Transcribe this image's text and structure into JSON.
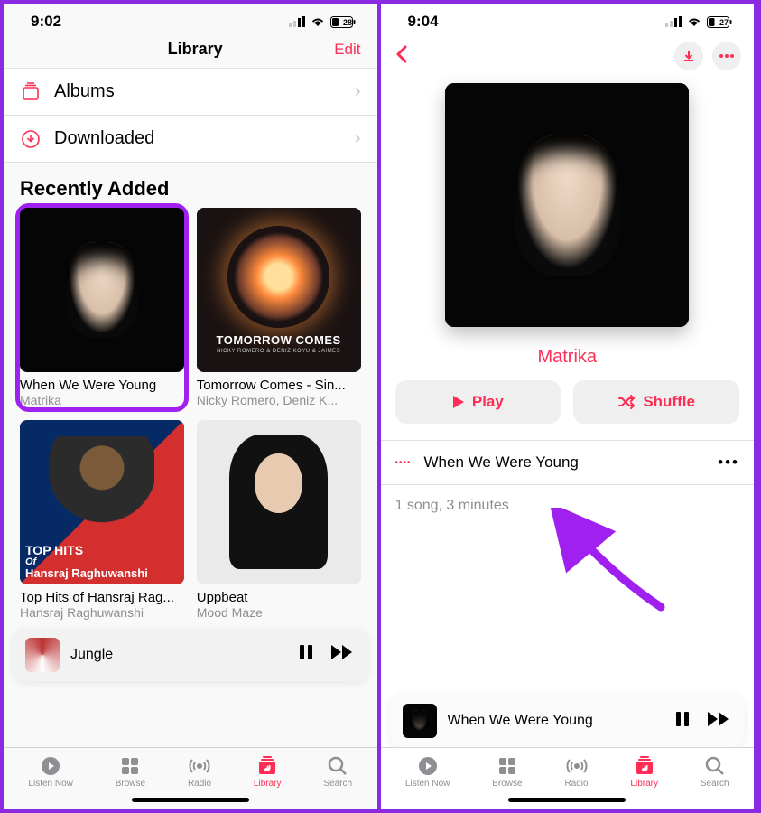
{
  "left": {
    "status": {
      "time": "9:02",
      "battery": "28"
    },
    "header": {
      "title": "Library",
      "edit": "Edit"
    },
    "rows": {
      "albums": "Albums",
      "downloaded": "Downloaded"
    },
    "section": "Recently Added",
    "tiles": [
      {
        "title": "When We Were Young",
        "sub": "Matrika"
      },
      {
        "title": "Tomorrow Comes - Sin...",
        "sub": "Nicky Romero, Deniz K...",
        "art_label": "TOMORROW COMES",
        "art_sub": "NICKY ROMERO & DENIZ KOYU & JAIMES"
      },
      {
        "title": "Top Hits of Hansraj Rag...",
        "sub": "Hansraj Raghuwanshi",
        "art_l1": "TOP HITS",
        "art_l2": "Of",
        "art_l3": "Hansraj Raghuwanshi"
      },
      {
        "title": "Uppbeat",
        "sub": "Mood Maze"
      }
    ],
    "now_playing": "Jungle"
  },
  "right": {
    "status": {
      "time": "9:04",
      "battery": "27"
    },
    "artist": "Matrika",
    "play": "Play",
    "shuffle": "Shuffle",
    "track": "When We Were Young",
    "summary": "1 song, 3 minutes",
    "now_playing": "When We Were Young"
  },
  "tabs": {
    "listen": "Listen Now",
    "browse": "Browse",
    "radio": "Radio",
    "library": "Library",
    "search": "Search"
  }
}
